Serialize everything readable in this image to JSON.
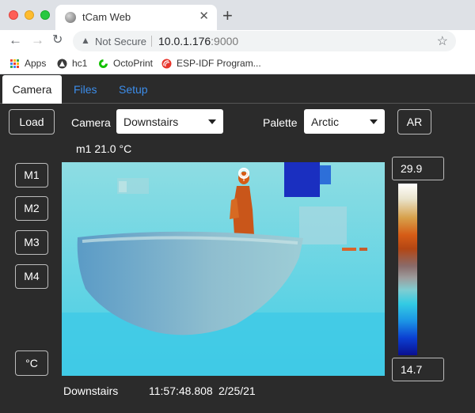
{
  "browser": {
    "tab_title": "tCam Web",
    "address": {
      "security_label": "Not Secure",
      "host": "10.0.1.176",
      "port": ":9000"
    },
    "bookmarks": [
      {
        "label": "Apps",
        "icon": "apps-grid-icon"
      },
      {
        "label": "hc1",
        "icon": "triangle-logo-icon"
      },
      {
        "label": "OctoPrint",
        "icon": "octoprint-icon"
      },
      {
        "label": "ESP-IDF Program...",
        "icon": "espressif-icon"
      }
    ]
  },
  "nav": {
    "tabs": [
      "Camera",
      "Files",
      "Setup"
    ],
    "active_tab": "Camera"
  },
  "controls": {
    "load_label": "Load",
    "camera_label": "Camera",
    "camera_value": "Downstairs",
    "palette_label": "Palette",
    "palette_value": "Arctic",
    "ar_label": "AR"
  },
  "markers": [
    "M1",
    "M2",
    "M3",
    "M4"
  ],
  "units_label": "°C",
  "marker_readout": "m1 21.0 °C",
  "scale": {
    "max_label": "29.9",
    "min_label": "14.7"
  },
  "status": {
    "camera_name": "Downstairs",
    "timestamp": "11:57:48.808",
    "date": "2/25/21"
  },
  "colors": {
    "accent": "#3c8dea",
    "page_bg": "#2b2b2b",
    "hot": "#d65c16",
    "cold": "#0a0f8f"
  }
}
